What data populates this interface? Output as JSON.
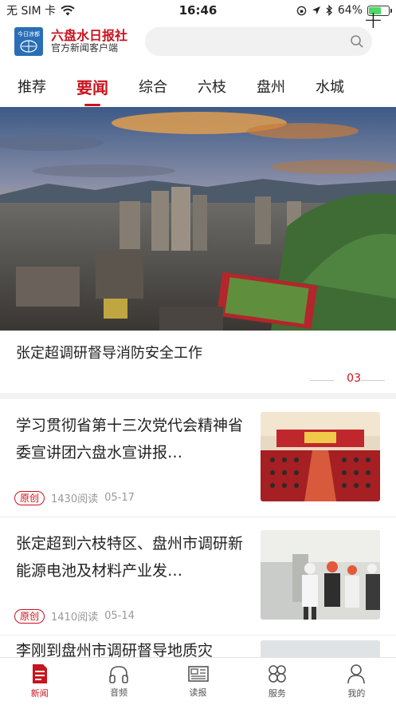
{
  "status_bar": {
    "carrier": "无 SIM 卡",
    "time": "16:46",
    "battery": "64%",
    "battery_level": 0.64
  },
  "header": {
    "logo_badge": "今日凉都",
    "logo_title": "六盘水日报社",
    "logo_subtitle": "官方新闻客户端",
    "search_placeholder": ""
  },
  "channels": [
    {
      "label": "推荐",
      "active": false
    },
    {
      "label": "要闻",
      "active": true
    },
    {
      "label": "综合",
      "active": false
    },
    {
      "label": "六枝",
      "active": false
    },
    {
      "label": "盘州",
      "active": false
    },
    {
      "label": "水城",
      "active": false
    }
  ],
  "banner": {
    "title": "张定超调研督导消防安全工作",
    "page": "03"
  },
  "news": [
    {
      "title": "学习贯彻省第十三次党代会精神省委宣讲团六盘水宣讲报…",
      "badge": "原创",
      "reads": "1430阅读",
      "date": "05-17"
    },
    {
      "title": "张定超到六枝特区、盘州市调研新能源电池及材料产业发…",
      "badge": "原创",
      "reads": "1410阅读",
      "date": "05-14"
    },
    {
      "title": "李刚到盘州市调研督导地质灾"
    }
  ],
  "tabs": [
    {
      "label": "新闻",
      "icon": "news-icon",
      "active": true
    },
    {
      "label": "音频",
      "icon": "headphones-icon",
      "active": false
    },
    {
      "label": "读报",
      "icon": "newspaper-icon",
      "active": false
    },
    {
      "label": "服务",
      "icon": "services-icon",
      "active": false
    },
    {
      "label": "我的",
      "icon": "profile-icon",
      "active": false
    }
  ],
  "colors": {
    "accent": "#c8141e",
    "battery": "#4cd964"
  }
}
